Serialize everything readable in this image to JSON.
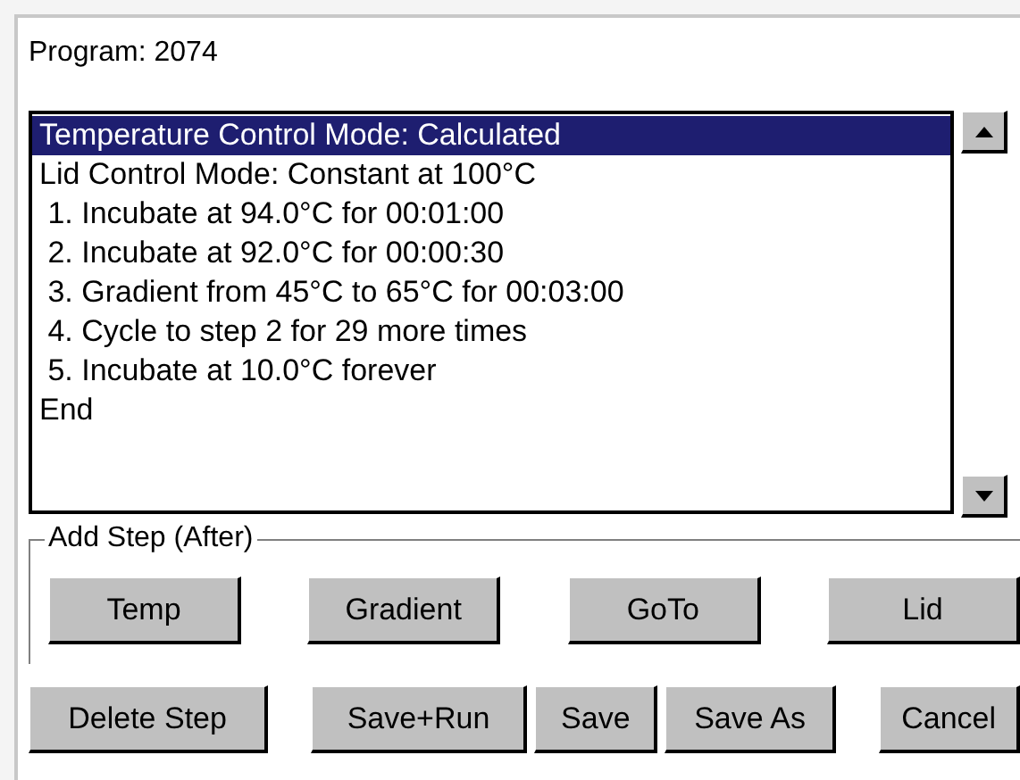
{
  "program_label": "Program: 2074",
  "steps": [
    {
      "text": "Temperature Control Mode: Calculated",
      "selected": true
    },
    {
      "text": "Lid Control Mode: Constant at 100°C",
      "selected": false
    },
    {
      "text": " 1. Incubate at 94.0°C for 00:01:00",
      "selected": false
    },
    {
      "text": " 2. Incubate at 92.0°C for 00:00:30",
      "selected": false
    },
    {
      "text": " 3. Gradient from 45°C to 65°C for 00:03:00",
      "selected": false
    },
    {
      "text": " 4. Cycle to step 2 for 29 more times",
      "selected": false
    },
    {
      "text": " 5. Incubate at 10.0°C forever",
      "selected": false
    },
    {
      "text": "End",
      "selected": false
    }
  ],
  "add_step": {
    "title": "Add Step (After)",
    "buttons": [
      "Temp",
      "Gradient",
      "GoTo",
      "Lid"
    ]
  },
  "bottom_buttons": [
    "Delete Step",
    "Save+Run",
    "Save",
    "Save As",
    "Cancel"
  ]
}
